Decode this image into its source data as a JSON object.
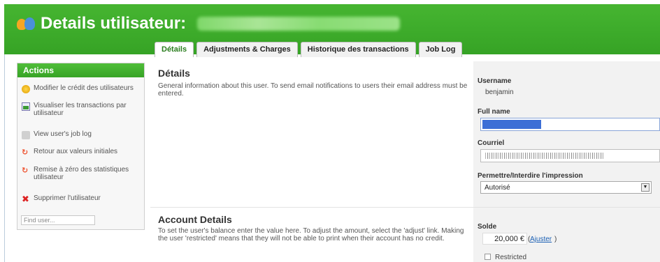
{
  "header": {
    "title": "Details utilisateur:"
  },
  "tabs": [
    {
      "label": "Détails",
      "active": true
    },
    {
      "label": "Adjustments & Charges",
      "active": false
    },
    {
      "label": "Historique des transactions",
      "active": false
    },
    {
      "label": "Job Log",
      "active": false
    }
  ],
  "sidebar": {
    "title": "Actions",
    "items": [
      {
        "label": "Modifier le crédit des utilisateurs",
        "icon": "coin-icon"
      },
      {
        "label": "Visualiser les transactions par utilisateur",
        "icon": "chart-icon"
      },
      {
        "label": "View user's job log",
        "icon": "printer-icon"
      },
      {
        "label": "Retour aux valeurs initiales",
        "icon": "reset-icon"
      },
      {
        "label": "Remise à zéro des statistiques utilisateur",
        "icon": "reset-stats-icon"
      },
      {
        "label": "Supprimer l'utilisateur",
        "icon": "delete-icon"
      }
    ],
    "find_placeholder": "Find user..."
  },
  "details": {
    "title": "Détails",
    "description": "General information about this user. To send email notifications to users their email address must be entered.",
    "username_label": "Username",
    "username_value": "benjamin",
    "fullname_label": "Full name",
    "email_label": "Courriel",
    "print_label": "Permettre/Interdire l'impression",
    "print_value": "Autorisé"
  },
  "account": {
    "title": "Account Details",
    "description": "To set the user's balance enter the value here. To adjust the amount, select the 'adjust' link. Making the user 'restricted' means that they will not be able to print when their account has no credit.",
    "balance_label": "Solde",
    "balance_value": "20,000 €",
    "adjust_link": "Ajuster",
    "restricted_label": "Restricted"
  },
  "colors": {
    "brand_green": "#3aa828",
    "link_blue": "#1a5fb4",
    "selection_blue": "#3d6fd6"
  }
}
